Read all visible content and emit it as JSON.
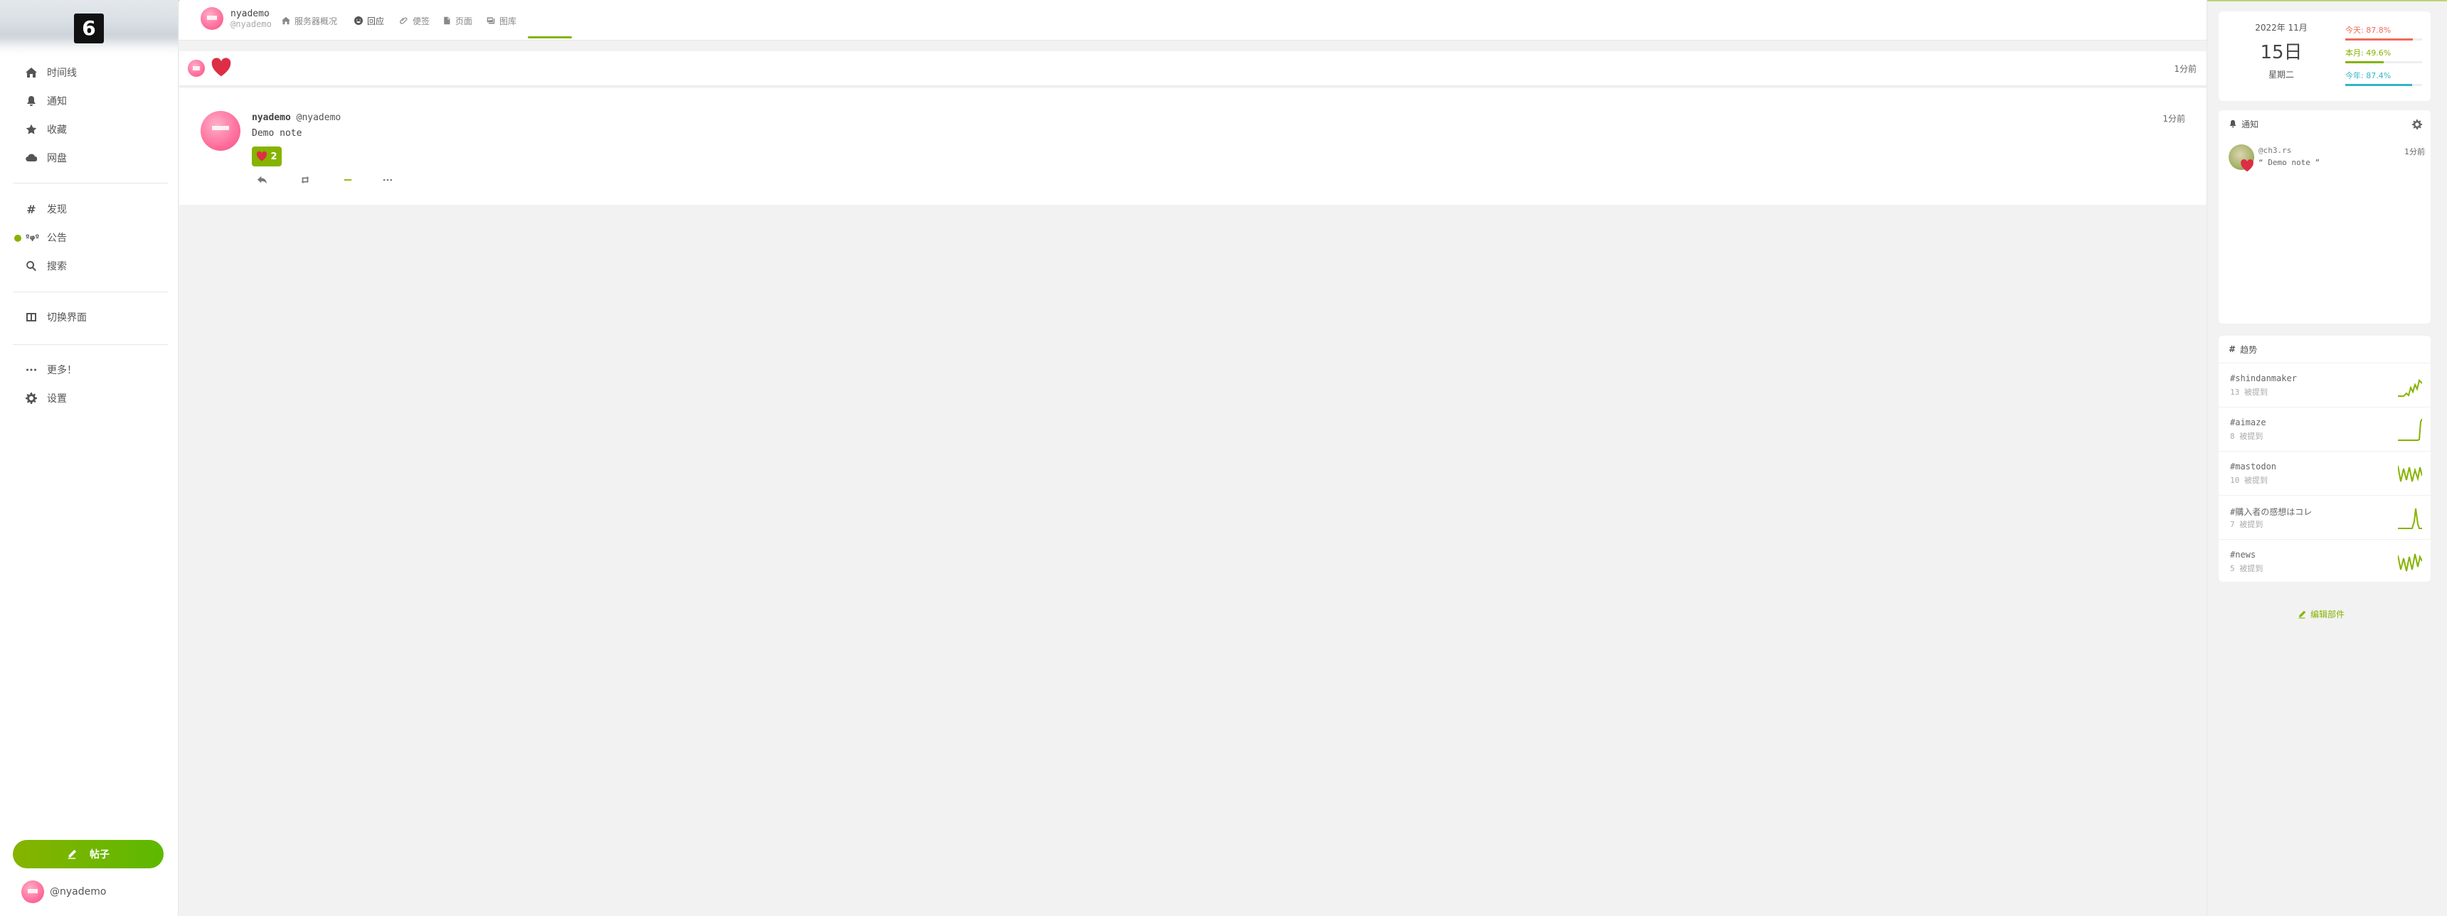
{
  "sidebar": {
    "logo_glyph": "6",
    "items": [
      {
        "label": "时间线",
        "icon": "home-icon"
      },
      {
        "label": "通知",
        "icon": "bell-icon"
      },
      {
        "label": "收藏",
        "icon": "star-icon"
      },
      {
        "label": "网盘",
        "icon": "cloud-icon"
      },
      {
        "label": "发现",
        "icon": "hashtag-icon"
      },
      {
        "label": "公告",
        "icon": "broadcast-icon",
        "icon_text": "ºφº"
      },
      {
        "label": "搜索",
        "icon": "search-icon"
      },
      {
        "label": "切换界面",
        "icon": "columns-icon"
      },
      {
        "label": "更多！",
        "icon": "ellipsis-icon"
      },
      {
        "label": "设置",
        "icon": "gear-icon"
      }
    ],
    "note_button": "帖子",
    "account": "@nyademo"
  },
  "header": {
    "user_name": "nyademo",
    "user_acct": "@nyademo",
    "tabs": [
      {
        "label": "服务器概况",
        "icon": "home-icon"
      },
      {
        "label": "回应",
        "icon": "smile-icon",
        "active": true
      },
      {
        "label": "便签",
        "icon": "paperclip-icon"
      },
      {
        "label": "页面",
        "icon": "file-icon"
      },
      {
        "label": "图库",
        "icon": "images-icon"
      }
    ]
  },
  "reaction_bar": {
    "time": "1分前"
  },
  "note": {
    "name": "nyademo",
    "acct": "@nyademo",
    "time": "1分前",
    "text": "Demo note",
    "reaction_count": "2"
  },
  "calendar": {
    "year_month": "2022年 11月",
    "day": "15日",
    "weekday": "星期二",
    "rows": [
      {
        "label": "今天: 87.8%",
        "value": 0.878,
        "color": "#ef6a5a"
      },
      {
        "label": "本月: 49.6%",
        "value": 0.496,
        "color": "#86b300"
      },
      {
        "label": "今年: 87.4%",
        "value": 0.874,
        "color": "#32b5c5"
      }
    ]
  },
  "notifications": {
    "title": "通知",
    "items": [
      {
        "user": "@ch3.rs",
        "text": "“ Demo note ”",
        "time": "1分前"
      }
    ]
  },
  "trends": {
    "title": "趋势",
    "items": [
      {
        "tag": "#shindanmaker",
        "sub": "13 被提到"
      },
      {
        "tag": "#aimaze",
        "sub": "8 被提到"
      },
      {
        "tag": "#mastodon",
        "sub": "10 被提到"
      },
      {
        "tag": "#購入者の感想はコレ",
        "sub": "7 被提到"
      },
      {
        "tag": "#news",
        "sub": "5 被提到"
      }
    ]
  },
  "edit_widgets": "编辑部件",
  "colors": {
    "accent": "#86b300",
    "like": "#dd2e44"
  }
}
